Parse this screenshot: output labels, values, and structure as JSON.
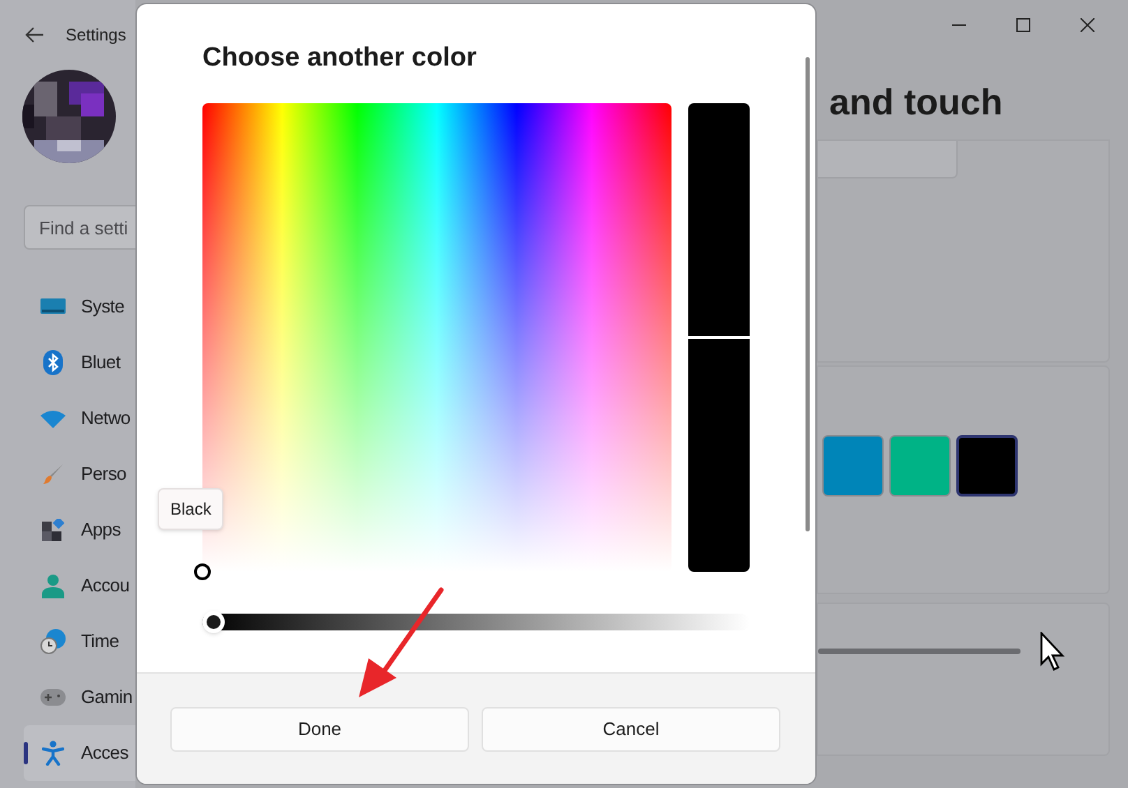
{
  "window": {
    "title": "Settings"
  },
  "sidebar": {
    "search": {
      "placeholder": "Find a setti"
    },
    "items": [
      {
        "label": "Syste",
        "kind": "display",
        "selected": false
      },
      {
        "label": "Bluet",
        "kind": "bluetooth",
        "selected": false
      },
      {
        "label": "Netwo",
        "kind": "wifi",
        "selected": false
      },
      {
        "label": "Perso",
        "kind": "brush",
        "selected": false
      },
      {
        "label": "Apps",
        "kind": "apps",
        "selected": false
      },
      {
        "label": "Accou",
        "kind": "person",
        "selected": false
      },
      {
        "label": "Time",
        "kind": "clock",
        "selected": false
      },
      {
        "label": "Gamin",
        "kind": "gamepad",
        "selected": false
      },
      {
        "label": "Acces",
        "kind": "accessibility",
        "selected": true
      }
    ]
  },
  "page": {
    "heading": "and touch",
    "swatches": [
      {
        "color": "#0085b8",
        "selected": false
      },
      {
        "color": "#00b386",
        "selected": false
      },
      {
        "color": "#000000",
        "selected": true
      }
    ]
  },
  "dialog": {
    "title": "Choose another color",
    "tooltip": "Black",
    "value_slider": {
      "level": 0
    },
    "buttons": [
      {
        "label": "Done"
      },
      {
        "label": "Cancel"
      }
    ]
  }
}
